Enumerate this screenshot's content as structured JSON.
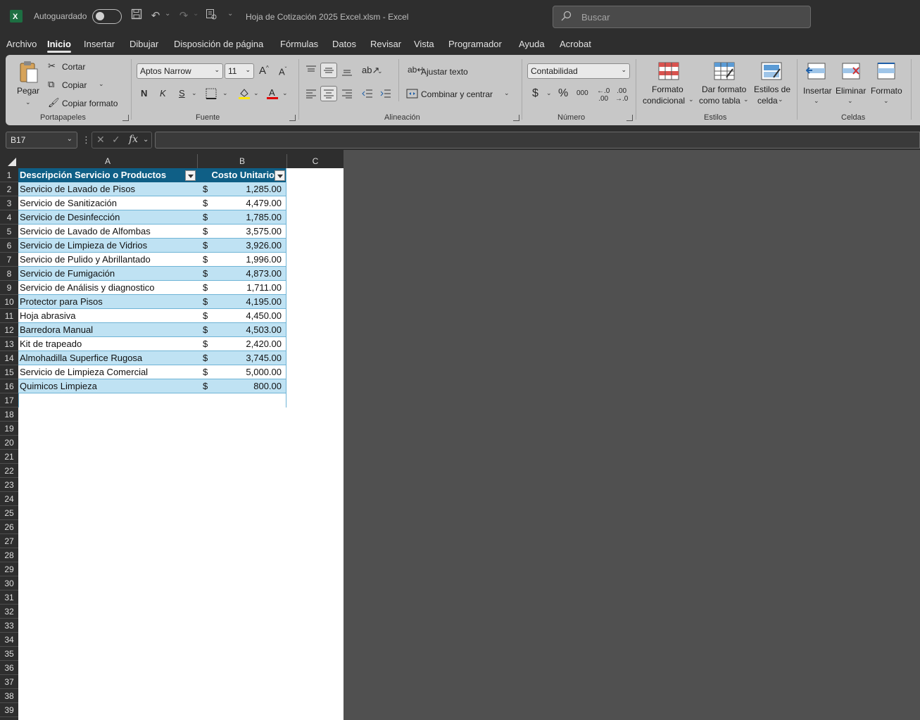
{
  "titlebar": {
    "autosave_label": "Autoguardado",
    "doc_title": "Hoja de Cotización 2025 Excel.xlsm  -  Excel",
    "search_placeholder": "Buscar"
  },
  "tabs": [
    "Archivo",
    "Inicio",
    "Insertar",
    "Dibujar",
    "Disposición de página",
    "Fórmulas",
    "Datos",
    "Revisar",
    "Vista",
    "Programador",
    "Ayuda",
    "Acrobat"
  ],
  "active_tab": "Inicio",
  "ribbon": {
    "clipboard": {
      "paste": "Pegar",
      "cut": "Cortar",
      "copy": "Copiar",
      "format_painter": "Copiar formato",
      "label": "Portapapeles"
    },
    "font": {
      "name": "Aptos Narrow",
      "size": "11",
      "bold": "N",
      "italic": "K",
      "underline": "S",
      "label": "Fuente"
    },
    "alignment": {
      "wrap": "Ajustar texto",
      "merge": "Combinar y centrar",
      "label": "Alineación"
    },
    "number": {
      "format": "Contabilidad",
      "currency": "$",
      "percent": "%",
      "thousands": "000",
      "label": "Número"
    },
    "styles": {
      "conditional_1": "Formato",
      "conditional_2": "condicional",
      "table_1": "Dar formato",
      "table_2": "como tabla",
      "cell_1": "Estilos de",
      "cell_2": "celda",
      "label": "Estilos"
    },
    "cells": {
      "insert": "Insertar",
      "delete": "Eliminar",
      "format": "Formato",
      "label": "Celdas"
    }
  },
  "formula_bar": {
    "name_box": "B17",
    "fx": "fx",
    "value": ""
  },
  "columns": [
    "A",
    "B",
    "C"
  ],
  "table": {
    "headers": [
      "Descripción Servicio o Productos",
      "Costo Unitario"
    ],
    "currency_symbol": "$",
    "rows": [
      {
        "desc": "Servicio de Lavado de Pisos",
        "cost": "1,285.00"
      },
      {
        "desc": "Servicio de Sanitización",
        "cost": "4,479.00"
      },
      {
        "desc": "Servicio de Desinfección",
        "cost": "1,785.00"
      },
      {
        "desc": "Servicio de Lavado de Alfombas",
        "cost": "3,575.00"
      },
      {
        "desc": "Servicio de Limpieza de Vidrios",
        "cost": "3,926.00"
      },
      {
        "desc": "Servicio de Pulido y Abrillantado",
        "cost": "1,996.00"
      },
      {
        "desc": "Servicio de Fumigación",
        "cost": "4,873.00"
      },
      {
        "desc": "Servicio de Análisis y diagnostico",
        "cost": "1,711.00"
      },
      {
        "desc": "Protector para Pisos",
        "cost": "4,195.00"
      },
      {
        "desc": "Hoja abrasiva",
        "cost": "4,450.00"
      },
      {
        "desc": "Barredora Manual",
        "cost": "4,503.00"
      },
      {
        "desc": "Kit de trapeado",
        "cost": "2,420.00"
      },
      {
        "desc": "Almohadilla Superfice Rugosa",
        "cost": "3,745.00"
      },
      {
        "desc": "Servicio de Limpieza Comercial",
        "cost": "5,000.00"
      },
      {
        "desc": "Quimicos Limpieza",
        "cost": "800.00"
      }
    ]
  },
  "row_numbers": [
    "1",
    "2",
    "3",
    "4",
    "5",
    "6",
    "7",
    "8",
    "9",
    "10",
    "11",
    "12",
    "13",
    "14",
    "15",
    "16",
    "17",
    "18",
    "19",
    "20",
    "21",
    "22",
    "23",
    "24",
    "25",
    "26",
    "27",
    "28",
    "29",
    "30",
    "31",
    "32",
    "33",
    "34",
    "35",
    "36",
    "37",
    "38",
    "39"
  ],
  "colors": {
    "header_fill": "#0f5f86",
    "band_fill": "#bfe2f3",
    "excel_green": "#1d6f42"
  }
}
